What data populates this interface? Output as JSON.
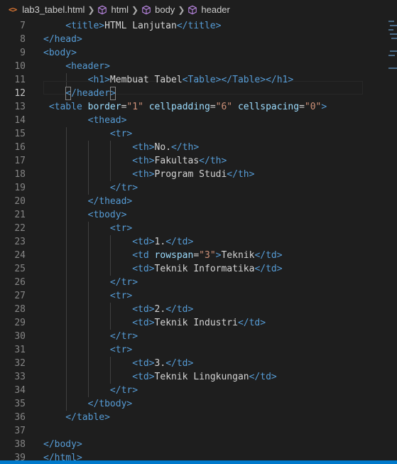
{
  "breadcrumb": {
    "file": "lab3_tabel.html",
    "items": [
      "html",
      "body",
      "header"
    ],
    "file_icon": "<>",
    "file_icon_color": "#e37933"
  },
  "editor": {
    "current_line": 12,
    "colors": {
      "background": "#1e1e1e",
      "tag": "#569cd6",
      "attribute": "#9cdcfe",
      "value": "#ce9178",
      "text": "#d4d4d4",
      "bracket": "#808080",
      "line_number": "#858585",
      "statusbar": "#007acc"
    },
    "lines": [
      {
        "n": "7",
        "t": [
          [
            "tk-tag",
            "    <title>"
          ],
          [
            "tk-txt",
            "HTML Lanjutan"
          ],
          [
            "tk-tag",
            "</title>"
          ]
        ]
      },
      {
        "n": "8",
        "t": [
          [
            "tk-tag",
            "</head>"
          ]
        ]
      },
      {
        "n": "9",
        "t": [
          [
            "tk-tag",
            "<body>"
          ]
        ]
      },
      {
        "n": "10",
        "t": [
          [
            "tk-tag",
            "    <header>"
          ]
        ]
      },
      {
        "n": "11",
        "t": [
          [
            "tk-tag",
            "        <h1>"
          ],
          [
            "tk-txt",
            "Membuat Tabel"
          ],
          [
            "tk-tag",
            "<Table></Table></h1>"
          ]
        ]
      },
      {
        "n": "12",
        "t": [
          [
            "tk-tag",
            "    </header>"
          ]
        ]
      },
      {
        "n": "13",
        "t": [
          [
            "tk-tag",
            " <table "
          ],
          [
            "tk-attr",
            "border"
          ],
          [
            "tk-eq",
            "="
          ],
          [
            "tk-val",
            "\"1\""
          ],
          [
            "tk-attr",
            " cellpadding"
          ],
          [
            "tk-eq",
            "="
          ],
          [
            "tk-val",
            "\"6\""
          ],
          [
            "tk-attr",
            " cellspacing"
          ],
          [
            "tk-eq",
            "="
          ],
          [
            "tk-val",
            "\"0\""
          ],
          [
            "tk-tag",
            ">"
          ]
        ]
      },
      {
        "n": "14",
        "t": [
          [
            "tk-tag",
            "        <thead>"
          ]
        ]
      },
      {
        "n": "15",
        "t": [
          [
            "tk-tag",
            "            <tr>"
          ]
        ]
      },
      {
        "n": "16",
        "t": [
          [
            "tk-tag",
            "                <th>"
          ],
          [
            "tk-txt",
            "No."
          ],
          [
            "tk-tag",
            "</th>"
          ]
        ]
      },
      {
        "n": "17",
        "t": [
          [
            "tk-tag",
            "                <th>"
          ],
          [
            "tk-txt",
            "Fakultas"
          ],
          [
            "tk-tag",
            "</th>"
          ]
        ]
      },
      {
        "n": "18",
        "t": [
          [
            "tk-tag",
            "                <th>"
          ],
          [
            "tk-txt",
            "Program Studi"
          ],
          [
            "tk-tag",
            "</th>"
          ]
        ]
      },
      {
        "n": "19",
        "t": [
          [
            "tk-tag",
            "            </tr>"
          ]
        ]
      },
      {
        "n": "20",
        "t": [
          [
            "tk-tag",
            "        </thead>"
          ]
        ]
      },
      {
        "n": "21",
        "t": [
          [
            "tk-tag",
            "        <tbody>"
          ]
        ]
      },
      {
        "n": "22",
        "t": [
          [
            "tk-tag",
            "            <tr>"
          ]
        ]
      },
      {
        "n": "23",
        "t": [
          [
            "tk-tag",
            "                <td>"
          ],
          [
            "tk-txt",
            "1."
          ],
          [
            "tk-tag",
            "</td>"
          ]
        ]
      },
      {
        "n": "24",
        "t": [
          [
            "tk-tag",
            "                <td "
          ],
          [
            "tk-attr",
            "rowspan"
          ],
          [
            "tk-eq",
            "="
          ],
          [
            "tk-val",
            "\"3\""
          ],
          [
            "tk-tag",
            ">"
          ],
          [
            "tk-txt",
            "Teknik"
          ],
          [
            "tk-tag",
            "</td>"
          ]
        ]
      },
      {
        "n": "25",
        "t": [
          [
            "tk-tag",
            "                <td>"
          ],
          [
            "tk-txt",
            "Teknik Informatika"
          ],
          [
            "tk-tag",
            "</td>"
          ]
        ]
      },
      {
        "n": "26",
        "t": [
          [
            "tk-tag",
            "            </tr>"
          ]
        ]
      },
      {
        "n": "27",
        "t": [
          [
            "tk-tag",
            "            <tr>"
          ]
        ]
      },
      {
        "n": "28",
        "t": [
          [
            "tk-tag",
            "                <td>"
          ],
          [
            "tk-txt",
            "2."
          ],
          [
            "tk-tag",
            "</td>"
          ]
        ]
      },
      {
        "n": "29",
        "t": [
          [
            "tk-tag",
            "                <td>"
          ],
          [
            "tk-txt",
            "Teknik Industri"
          ],
          [
            "tk-tag",
            "</td>"
          ]
        ]
      },
      {
        "n": "30",
        "t": [
          [
            "tk-tag",
            "            </tr>"
          ]
        ]
      },
      {
        "n": "31",
        "t": [
          [
            "tk-tag",
            "            <tr>"
          ]
        ]
      },
      {
        "n": "32",
        "t": [
          [
            "tk-tag",
            "                <td>"
          ],
          [
            "tk-txt",
            "3."
          ],
          [
            "tk-tag",
            "</td>"
          ]
        ]
      },
      {
        "n": "33",
        "t": [
          [
            "tk-tag",
            "                <td>"
          ],
          [
            "tk-txt",
            "Teknik Lingkungan"
          ],
          [
            "tk-tag",
            "</td>"
          ]
        ]
      },
      {
        "n": "34",
        "t": [
          [
            "tk-tag",
            "            </tr>"
          ]
        ]
      },
      {
        "n": "35",
        "t": [
          [
            "tk-tag",
            "        </tbody>"
          ]
        ]
      },
      {
        "n": "36",
        "t": [
          [
            "tk-tag",
            "    </table>"
          ]
        ]
      },
      {
        "n": "37",
        "t": []
      },
      {
        "n": "38",
        "t": [
          [
            "tk-tag",
            "</body>"
          ]
        ]
      },
      {
        "n": "39",
        "t": [
          [
            "tk-tag",
            "</html>"
          ]
        ]
      }
    ]
  }
}
